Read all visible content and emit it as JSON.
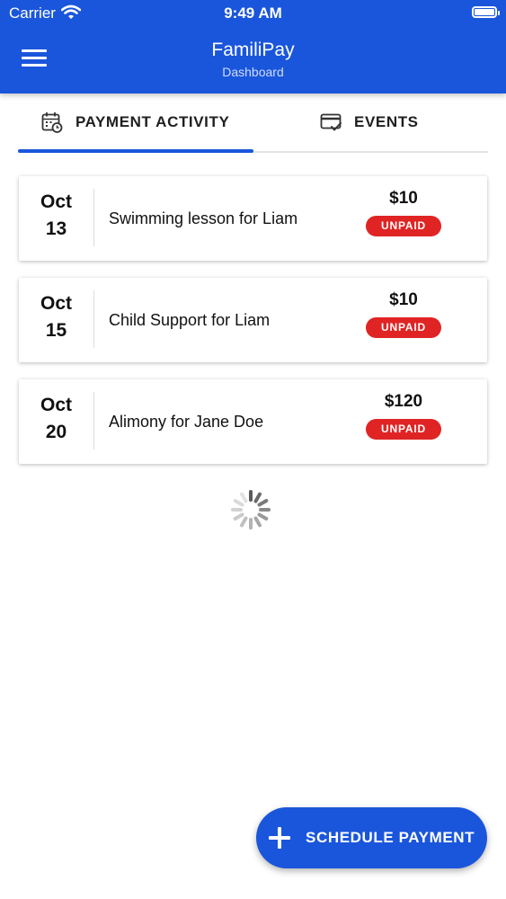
{
  "status_bar": {
    "carrier": "Carrier",
    "time": "9:49 AM"
  },
  "header": {
    "title": "FamiliPay",
    "subtitle": "Dashboard",
    "menu_icon": "hamburger-menu-icon"
  },
  "tabs": [
    {
      "label": "PAYMENT ACTIVITY",
      "icon": "calendar-clock-icon",
      "active": true
    },
    {
      "label": "EVENTS",
      "icon": "card-check-icon",
      "active": false
    }
  ],
  "payments": [
    {
      "month": "Oct",
      "day": "13",
      "description": "Swimming lesson for Liam",
      "amount": "$10",
      "status": "UNPAID"
    },
    {
      "month": "Oct",
      "day": "15",
      "description": "Child Support for Liam",
      "amount": "$10",
      "status": "UNPAID"
    },
    {
      "month": "Oct",
      "day": "20",
      "description": "Alimony for Jane Doe",
      "amount": "$120",
      "status": "UNPAID"
    }
  ],
  "fab": {
    "label": "SCHEDULE PAYMENT",
    "icon": "plus-icon"
  },
  "colors": {
    "primary": "#1a56db",
    "unpaid": "#e02424",
    "background": "#ffffff"
  }
}
